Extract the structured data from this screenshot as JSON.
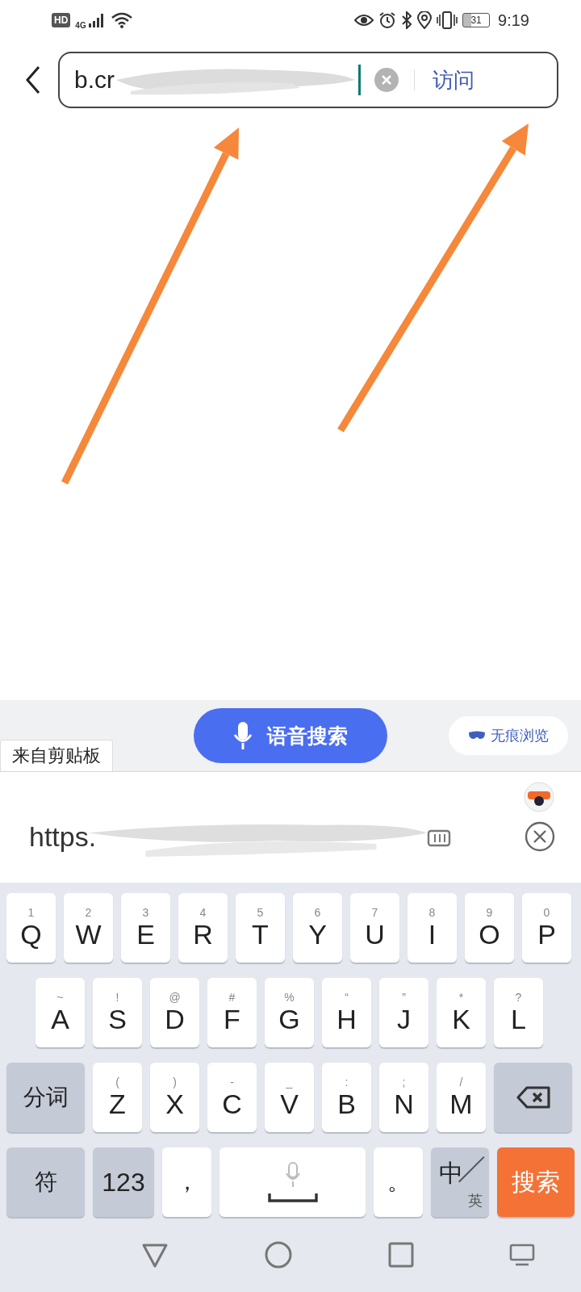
{
  "status_bar": {
    "hd": "HD",
    "network": "4G",
    "battery": "31",
    "time": "9:19"
  },
  "url_bar": {
    "value": "b.cr",
    "action": "访问"
  },
  "annotations": [
    {
      "kind": "arrow"
    },
    {
      "kind": "arrow"
    }
  ],
  "toolbar": {
    "clipboard_tab": "来自剪贴板",
    "voice_search": "语音搜索",
    "incognito": "无痕浏览"
  },
  "clipboard": {
    "text": "https."
  },
  "keyboard": {
    "rows": [
      {
        "keys": [
          {
            "kind": "letter",
            "label": "Q",
            "sub": "1"
          },
          {
            "kind": "letter",
            "label": "W",
            "sub": "2"
          },
          {
            "kind": "letter",
            "label": "E",
            "sub": "3"
          },
          {
            "kind": "letter",
            "label": "R",
            "sub": "4"
          },
          {
            "kind": "letter",
            "label": "T",
            "sub": "5"
          },
          {
            "kind": "letter",
            "label": "Y",
            "sub": "6"
          },
          {
            "kind": "letter",
            "label": "U",
            "sub": "7"
          },
          {
            "kind": "letter",
            "label": "I",
            "sub": "8"
          },
          {
            "kind": "letter",
            "label": "O",
            "sub": "9"
          },
          {
            "kind": "letter",
            "label": "P",
            "sub": "0"
          }
        ]
      },
      {
        "keys": [
          {
            "kind": "letter",
            "label": "A",
            "sub": "~"
          },
          {
            "kind": "letter",
            "label": "S",
            "sub": "!"
          },
          {
            "kind": "letter",
            "label": "D",
            "sub": "@"
          },
          {
            "kind": "letter",
            "label": "F",
            "sub": "#"
          },
          {
            "kind": "letter",
            "label": "G",
            "sub": "%"
          },
          {
            "kind": "letter",
            "label": "H",
            "sub": "“"
          },
          {
            "kind": "letter",
            "label": "J",
            "sub": "”"
          },
          {
            "kind": "letter",
            "label": "K",
            "sub": "*"
          },
          {
            "kind": "letter",
            "label": "L",
            "sub": "?"
          }
        ]
      },
      {
        "keys": [
          {
            "kind": "modifier",
            "label": "分词"
          },
          {
            "kind": "letter",
            "label": "Z",
            "sub": "("
          },
          {
            "kind": "letter",
            "label": "X",
            "sub": ")"
          },
          {
            "kind": "letter",
            "label": "C",
            "sub": "-"
          },
          {
            "kind": "letter",
            "label": "V",
            "sub": "_"
          },
          {
            "kind": "letter",
            "label": "B",
            "sub": ":"
          },
          {
            "kind": "letter",
            "label": "N",
            "sub": ";"
          },
          {
            "kind": "letter",
            "label": "M",
            "sub": "/"
          },
          {
            "kind": "backspace"
          }
        ]
      },
      {
        "keys": [
          {
            "kind": "modifier",
            "label": "符"
          },
          {
            "kind": "numbers",
            "label": "123"
          },
          {
            "kind": "punct",
            "label": "，"
          },
          {
            "kind": "space"
          },
          {
            "kind": "punct",
            "label": "。"
          },
          {
            "kind": "lang",
            "label": "中",
            "sub": "英"
          },
          {
            "kind": "search",
            "label": "搜索"
          }
        ]
      }
    ]
  },
  "nav_bar": {
    "buttons": [
      {
        "kind": "back"
      },
      {
        "kind": "home"
      },
      {
        "kind": "recents"
      },
      {
        "kind": "hide_keyboard"
      }
    ]
  }
}
